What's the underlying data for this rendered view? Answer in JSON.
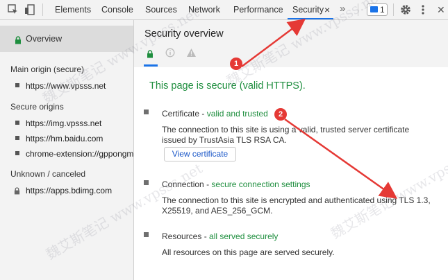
{
  "toolbar": {
    "tabs": [
      {
        "label": "Elements"
      },
      {
        "label": "Console"
      },
      {
        "label": "Sources"
      },
      {
        "label": "Network"
      },
      {
        "label": "Performance"
      },
      {
        "label": "Security"
      }
    ],
    "close_tab_glyph": "×",
    "more_tabs_glyph": "»",
    "message_count": "1",
    "close_glyph": "✕",
    "icons": [
      "inspect-icon",
      "device-toggle-icon",
      "message-icon",
      "gear-icon",
      "kebab-menu-icon",
      "close-icon"
    ],
    "accent_color": "#1a73e8"
  },
  "sidebar": {
    "overview_label": "Overview",
    "sections": [
      {
        "heading": "Main origin (secure)",
        "items": [
          "https://www.vpsss.net"
        ]
      },
      {
        "heading": "Secure origins",
        "items": [
          "https://img.vpsss.net",
          "https://hm.baidu.com",
          "chrome-extension://gppongmh"
        ]
      },
      {
        "heading": "Unknown / canceled",
        "items": [
          "https://apps.bdimg.com"
        ]
      }
    ]
  },
  "main": {
    "title": "Security overview",
    "secure_message": "This page is secure (valid HTTPS).",
    "secure_color": "#1e8e3e",
    "certificate": {
      "title": "Certificate",
      "status": "valid and trusted",
      "description": "The connection to this site is using a valid, trusted server certificate issued by TrustAsia TLS RSA CA.",
      "button": "View certificate"
    },
    "connection": {
      "title": "Connection",
      "status": "secure connection settings",
      "description": "The connection to this site is encrypted and authenticated using TLS 1.3, X25519, and AES_256_GCM."
    },
    "resources": {
      "title": "Resources",
      "status": "all served securely",
      "description": "All resources on this page are served securely."
    }
  },
  "annotations": {
    "markers": [
      "1",
      "2"
    ],
    "color": "#e53935"
  },
  "watermarks": [
    "魏艾斯笔记",
    "www.vpsss.net"
  ]
}
